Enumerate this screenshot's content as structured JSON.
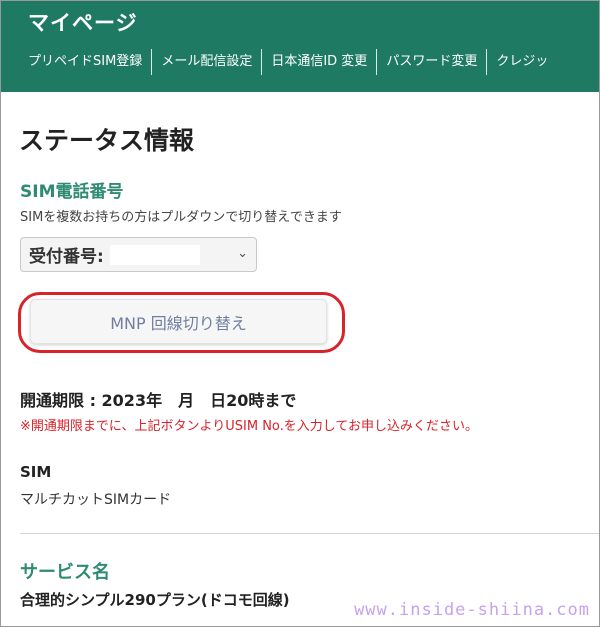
{
  "header": {
    "title": "マイページ",
    "nav": [
      "プリペイドSIM登録",
      "メール配信設定",
      "日本通信ID 変更",
      "パスワード変更",
      "クレジッ"
    ]
  },
  "status": {
    "title": "ステータス情報",
    "sim_phone_heading": "SIM電話番号",
    "sim_note": "SIMを複数お持ちの方はプルダウンで切り替えできます",
    "select_label": "受付番号:",
    "mnp_button": "MNP 回線切り替え",
    "deadline": "開通期限 : 2023年　月　日20時まで",
    "warning": "※開通期限までに、上記ボタンよりUSIM No.を入力してお申し込みください。",
    "sim_label": "SIM",
    "sim_value": "マルチカットSIMカード",
    "service_heading": "サービス名",
    "service_value": "合理的シンプル290プラン(ドコモ回線)"
  },
  "watermark": "www.inside-shiina.com",
  "colors": {
    "brand": "#1f7a63",
    "accent_heading": "#2f8b73",
    "warning": "#d8232a",
    "highlight": "#d8232a"
  }
}
